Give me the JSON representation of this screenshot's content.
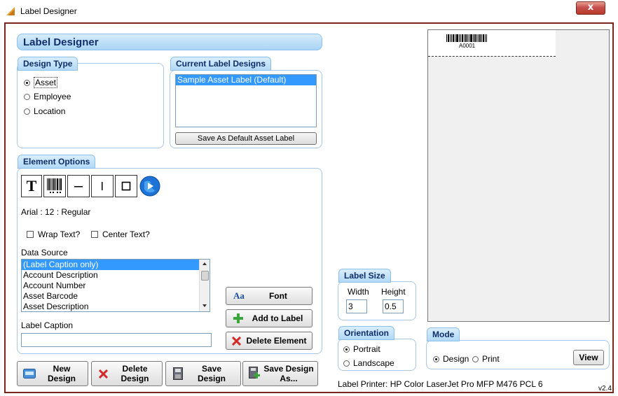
{
  "window": {
    "title": "Label Designer",
    "close_glyph": "x"
  },
  "header": {
    "title": "Label Designer"
  },
  "design_type": {
    "title": "Design Type",
    "options": [
      {
        "label": "Asset",
        "selected": true
      },
      {
        "label": "Employee",
        "selected": false
      },
      {
        "label": "Location",
        "selected": false
      }
    ]
  },
  "current_designs": {
    "title": "Current Label Designs",
    "items": [
      "Sample Asset Label  (Default)"
    ],
    "save_default_label": "Save As Default Asset Label"
  },
  "element_options": {
    "title": "Element Options",
    "font_desc": "Arial : 12 : Regular",
    "wrap_text_label": "Wrap Text?",
    "center_text_label": "Center Text?",
    "data_source_label": "Data Source",
    "data_source_items": [
      "(Label Caption only)",
      "Account Description",
      "Account Number",
      "Asset Barcode",
      "Asset Description"
    ],
    "label_caption_label": "Label Caption",
    "label_caption_value": "",
    "font_button": "Font",
    "add_button": "Add to Label",
    "delete_element_button": "Delete Element",
    "text_tool_glyph": "T"
  },
  "footer_buttons": {
    "new_l1": "New",
    "new_l2": "Design",
    "delete_l1": "Delete",
    "delete_l2": "Design",
    "save_l1": "Save",
    "save_l2": "Design",
    "saveas_l1": "Save Design",
    "saveas_l2": "As..."
  },
  "label_size": {
    "title": "Label Size",
    "width_label": "Width",
    "height_label": "Height",
    "width_value": "3",
    "height_value": "0.5"
  },
  "orientation": {
    "title": "Orientation",
    "portrait": "Portrait",
    "landscape": "Landscape"
  },
  "mode": {
    "title": "Mode",
    "design": "Design",
    "print": "Print",
    "view_button": "View"
  },
  "printer": {
    "text": "Label Printer:  HP Color LaserJet Pro MFP M476 PCL 6"
  },
  "preview": {
    "barcode_text": "A0001"
  },
  "version": "v2.4",
  "colors": {
    "accent": "#122f6b",
    "selection": "#3399ff",
    "border": "#7a2519"
  }
}
